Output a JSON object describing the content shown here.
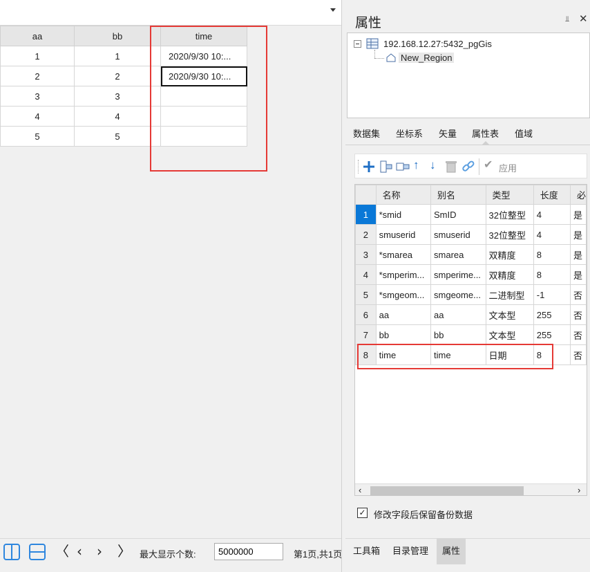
{
  "grid": {
    "headers": [
      "aa",
      "bb",
      "time"
    ],
    "rows": [
      [
        "1",
        "1",
        "2020/9/30 10:..."
      ],
      [
        "2",
        "2",
        "2020/9/30 10:..."
      ],
      [
        "3",
        "3",
        ""
      ],
      [
        "4",
        "4",
        ""
      ],
      [
        "5",
        "5",
        ""
      ]
    ]
  },
  "bottombar": {
    "max_label": "最大显示个数:",
    "max_value": "5000000",
    "page_info": "第1页,共1页"
  },
  "panel": {
    "title": "属性",
    "tree": {
      "root": "192.168.12.27:5432_pgGis",
      "child": "New_Region"
    },
    "tabs": [
      "数据集",
      "坐标系",
      "矢量",
      "属性表",
      "值域"
    ],
    "active_tab": "属性表",
    "toolbar": {
      "apply_label": "应用"
    },
    "fields": {
      "headers": [
        "名称",
        "别名",
        "类型",
        "长度",
        "必"
      ],
      "rows": [
        [
          "1",
          "*smid",
          "SmID",
          "32位整型",
          "4",
          "是"
        ],
        [
          "2",
          "smuserid",
          "smuserid",
          "32位整型",
          "4",
          "是"
        ],
        [
          "3",
          "*smarea",
          "smarea",
          "双精度",
          "8",
          "是"
        ],
        [
          "4",
          "*smperim...",
          "smperime...",
          "双精度",
          "8",
          "是"
        ],
        [
          "5",
          "*smgeom...",
          "smgeome...",
          "二进制型",
          "-1",
          "否"
        ],
        [
          "6",
          "aa",
          "aa",
          "文本型",
          "255",
          "否"
        ],
        [
          "7",
          "bb",
          "bb",
          "文本型",
          "255",
          "否"
        ],
        [
          "8",
          "time",
          "time",
          "日期",
          "8",
          "否"
        ]
      ]
    },
    "checkbox_label": "修改字段后保留备份数据",
    "bottom_tabs": [
      "工具箱",
      "目录管理",
      "属性"
    ]
  }
}
